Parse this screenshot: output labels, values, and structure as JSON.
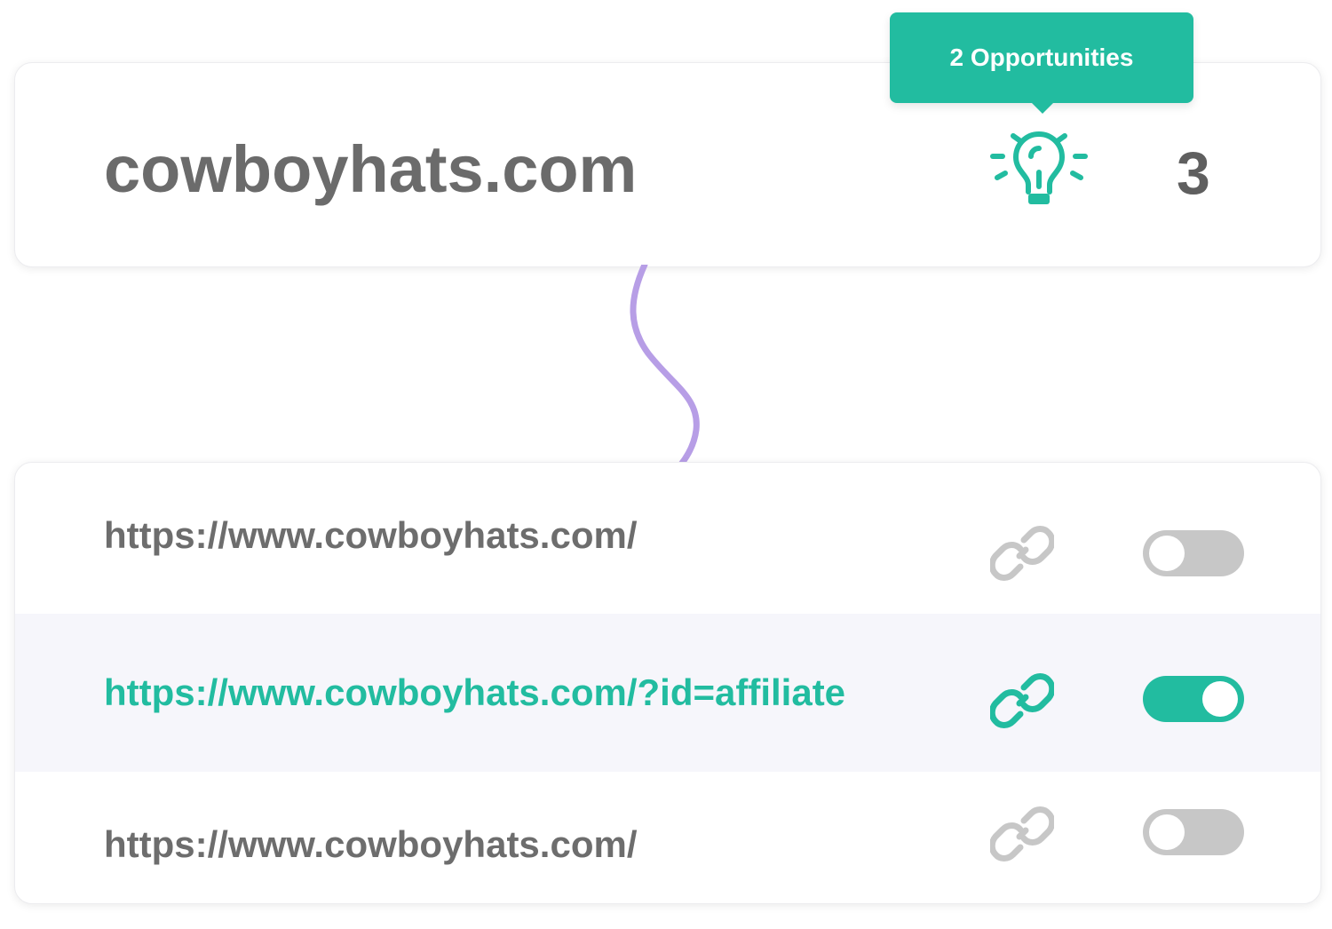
{
  "domain": {
    "name": "cowboyhats.com",
    "count": "3",
    "tooltip": "2 Opportunities",
    "icon": "lightbulb-icon"
  },
  "colors": {
    "accent": "#22bca0",
    "text_gray": "#6b6b6b",
    "toggle_off": "#c7c7c7",
    "connector": "#b79ee6",
    "highlight_row": "#f6f6fb"
  },
  "urls": [
    {
      "url": "https://www.cowboyhats.com/",
      "active": false,
      "icon": "link-icon",
      "toggle": "off"
    },
    {
      "url": "https://www.cowboyhats.com/?id=affiliate",
      "active": true,
      "icon": "link-icon",
      "toggle": "on"
    },
    {
      "url": "https://www.cowboyhats.com/",
      "active": false,
      "icon": "link-icon",
      "toggle": "off"
    }
  ]
}
